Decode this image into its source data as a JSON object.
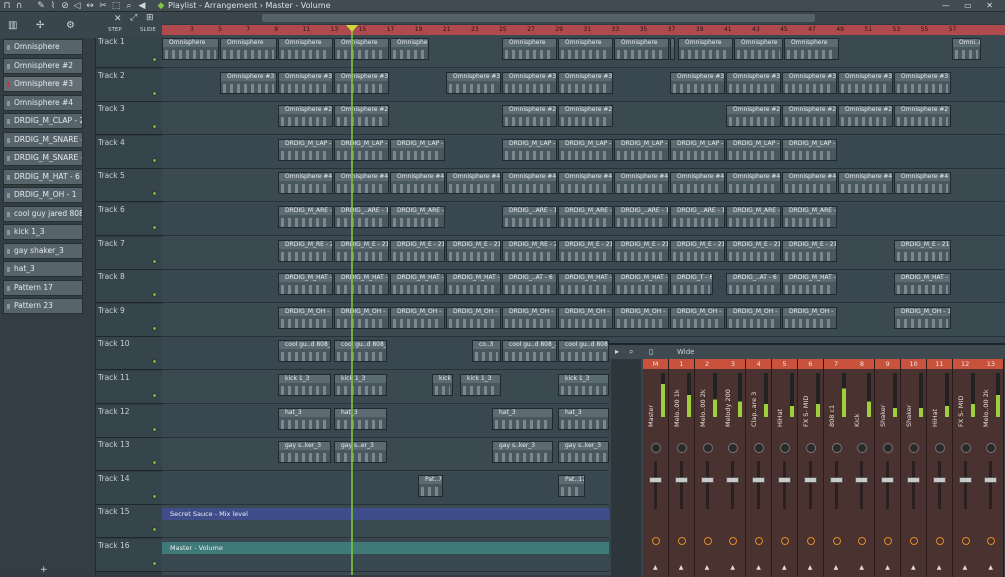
{
  "titlebar": {
    "title": "Playlist - Arrangement",
    "separator": "›",
    "target": "Master - Volume",
    "icons": [
      "magnet-icon",
      "draw-icon",
      "paint-icon",
      "delete-icon",
      "mute-icon",
      "slip-icon",
      "slice-icon",
      "select-icon",
      "zoom-icon",
      "playback-icon"
    ],
    "window_controls": "— ▭ ✕"
  },
  "playlist_tools": {
    "step_label": "STEP",
    "slide_label": "SLIDE"
  },
  "browser": {
    "channels": [
      {
        "label": "Omnisphere",
        "led": "gray"
      },
      {
        "label": "Omnisphere #2",
        "led": "gray"
      },
      {
        "label": "Omnisphere #3",
        "led": "red"
      },
      {
        "label": "Omnisphere #4",
        "led": "gray"
      },
      {
        "label": "DRDIG_M_CLAP - 2",
        "led": "gray"
      },
      {
        "label": "DRDIG_M_SNARE - 21",
        "led": "gray"
      },
      {
        "label": "DRDIG_M_SNARE - 1",
        "led": "gray"
      },
      {
        "label": "DRDIG_M_HAT - 6",
        "led": "gray"
      },
      {
        "label": "DRDIG_M_OH - 1",
        "led": "gray"
      },
      {
        "label": "cool guy jared 808_3",
        "led": "gray"
      },
      {
        "label": "kick 1_3",
        "led": "gray"
      },
      {
        "label": "gay shaker_3",
        "led": "gray"
      },
      {
        "label": "hat_3",
        "led": "gray"
      },
      {
        "label": "Pattern 17",
        "led": "gray"
      },
      {
        "label": "Pattern 23",
        "led": "gray"
      }
    ],
    "add_label": "+"
  },
  "ruler": {
    "bars": [
      "3",
      "5",
      "7",
      "9",
      "11",
      "13",
      "15",
      "17",
      "19",
      "21",
      "23",
      "25",
      "27",
      "29",
      "31",
      "33",
      "35",
      "37",
      "39",
      "41",
      "43",
      "45",
      "47",
      "49",
      "51",
      "53",
      "55",
      "57"
    ]
  },
  "tracks": [
    {
      "name": "Track 1",
      "clips": [
        {
          "start": 0,
          "end": 58,
          "label": "Omnisphere"
        },
        {
          "start": 58,
          "end": 116,
          "label": "Omnisphere"
        },
        {
          "start": 116,
          "end": 172,
          "label": "Omnisphere"
        },
        {
          "start": 172,
          "end": 228,
          "label": "Omnisphere"
        },
        {
          "start": 228,
          "end": 268,
          "label": "Omnisphere"
        },
        {
          "start": 340,
          "end": 396,
          "label": "Omnisphere"
        },
        {
          "start": 396,
          "end": 452,
          "label": "Omnisphere"
        },
        {
          "start": 452,
          "end": 508,
          "label": "Omnisphere"
        },
        {
          "start": 508,
          "end": 514,
          "label": "Omnisphere"
        },
        {
          "start": 516,
          "end": 572,
          "label": "Omnisphere"
        },
        {
          "start": 572,
          "end": 622,
          "label": "Omnisphere"
        },
        {
          "start": 622,
          "end": 678,
          "label": "Omnisphere"
        },
        {
          "start": 790,
          "end": 820,
          "label": "Omni..re"
        }
      ]
    },
    {
      "name": "Track 2",
      "clips": [
        {
          "start": 58,
          "end": 116,
          "label": "Omnisphere #3"
        },
        {
          "start": 116,
          "end": 172,
          "label": "Omnisphere #3"
        },
        {
          "start": 172,
          "end": 228,
          "label": "Omnisphere #3"
        },
        {
          "start": 284,
          "end": 340,
          "label": "Omnisphere #3"
        },
        {
          "start": 340,
          "end": 396,
          "label": "Omnisphere #3"
        },
        {
          "start": 396,
          "end": 452,
          "label": "Omnisphere #3"
        },
        {
          "start": 508,
          "end": 564,
          "label": "Omnisphere #3"
        },
        {
          "start": 564,
          "end": 620,
          "label": "Omnisphere #3"
        },
        {
          "start": 620,
          "end": 676,
          "label": "Omnisphere #3"
        },
        {
          "start": 676,
          "end": 732,
          "label": "Omnisphere #3"
        },
        {
          "start": 732,
          "end": 790,
          "label": "Omnisphere #3"
        }
      ]
    },
    {
      "name": "Track 3",
      "clips": [
        {
          "start": 116,
          "end": 172,
          "label": "Omnisphere #2"
        },
        {
          "start": 172,
          "end": 228,
          "label": "Omnisphere #2"
        },
        {
          "start": 340,
          "end": 396,
          "label": "Omnisphere #2"
        },
        {
          "start": 396,
          "end": 452,
          "label": "Omnisphere #2"
        },
        {
          "start": 564,
          "end": 620,
          "label": "Omnisphere #2"
        },
        {
          "start": 620,
          "end": 676,
          "label": "Omnisphere #2"
        },
        {
          "start": 676,
          "end": 732,
          "label": "Omnisphere #2"
        },
        {
          "start": 732,
          "end": 790,
          "label": "Omnisphere #2"
        }
      ]
    },
    {
      "name": "Track 4",
      "clips": [
        {
          "start": 116,
          "end": 172,
          "label": "DRDIG_M_LAP - 2"
        },
        {
          "start": 172,
          "end": 228,
          "label": "DRDIG_M_LAP - 2"
        },
        {
          "start": 228,
          "end": 284,
          "label": "DRDIG_M_LAP - 2"
        },
        {
          "start": 340,
          "end": 396,
          "label": "DRDIG_M_LAP - 2"
        },
        {
          "start": 396,
          "end": 452,
          "label": "DRDIG_M_LAP - 2"
        },
        {
          "start": 452,
          "end": 508,
          "label": "DRDIG_M_LAP - 2"
        },
        {
          "start": 508,
          "end": 564,
          "label": "DRDIG_M_LAP - 2"
        },
        {
          "start": 564,
          "end": 620,
          "label": "DRDIG_M_LAP - 2"
        },
        {
          "start": 620,
          "end": 676,
          "label": "DRDIG_M_LAP - 2"
        }
      ]
    },
    {
      "name": "Track 5",
      "clips": [
        {
          "start": 116,
          "end": 172,
          "label": "Omnisphere #4"
        },
        {
          "start": 172,
          "end": 228,
          "label": "Omnisphere #4"
        },
        {
          "start": 228,
          "end": 284,
          "label": "Omnisphere #4"
        },
        {
          "start": 284,
          "end": 340,
          "label": "Omnisphere #4"
        },
        {
          "start": 340,
          "end": 396,
          "label": "Omnisphere #4"
        },
        {
          "start": 396,
          "end": 452,
          "label": "Omnisphere #4"
        },
        {
          "start": 452,
          "end": 508,
          "label": "Omnisphere #4"
        },
        {
          "start": 508,
          "end": 564,
          "label": "Omnisphere #4"
        },
        {
          "start": 564,
          "end": 620,
          "label": "Omnisphere #4"
        },
        {
          "start": 620,
          "end": 676,
          "label": "Omnisphere #4"
        },
        {
          "start": 676,
          "end": 732,
          "label": "Omnisphere #4"
        },
        {
          "start": 732,
          "end": 790,
          "label": "Omnisphere #4"
        }
      ]
    },
    {
      "name": "Track 6",
      "clips": [
        {
          "start": 116,
          "end": 172,
          "label": "DRDIG_M_ARE - 1"
        },
        {
          "start": 172,
          "end": 228,
          "label": "DRDIG_..ARE - 1"
        },
        {
          "start": 228,
          "end": 284,
          "label": "DRDIG_M_ARE - 1"
        },
        {
          "start": 340,
          "end": 396,
          "label": "DRDIG_..ARE - 1"
        },
        {
          "start": 396,
          "end": 452,
          "label": "DRDIG_M_ARE - 1"
        },
        {
          "start": 452,
          "end": 508,
          "label": "DRDIG_..ARE - 1"
        },
        {
          "start": 508,
          "end": 564,
          "label": "DRDIG_..ARE - 1"
        },
        {
          "start": 564,
          "end": 620,
          "label": "DRDIG_M_ARE - 1"
        },
        {
          "start": 620,
          "end": 676,
          "label": "DRDIG_M_ARE - 1"
        }
      ]
    },
    {
      "name": "Track 7",
      "clips": [
        {
          "start": 116,
          "end": 172,
          "label": "DRDIG_M_RE - 21"
        },
        {
          "start": 172,
          "end": 228,
          "label": "DRDIG_M_E - 21"
        },
        {
          "start": 228,
          "end": 284,
          "label": "DRDIG_M_E - 21"
        },
        {
          "start": 284,
          "end": 340,
          "label": "DRDIG_M_E - 21"
        },
        {
          "start": 340,
          "end": 396,
          "label": "DRDIG_M_RE - 21"
        },
        {
          "start": 396,
          "end": 452,
          "label": "DRDIG_M_E - 21"
        },
        {
          "start": 452,
          "end": 508,
          "label": "DRDIG_M_E - 21"
        },
        {
          "start": 508,
          "end": 564,
          "label": "DRDIG_M_E - 21"
        },
        {
          "start": 564,
          "end": 620,
          "label": "DRDIG_M_E - 21"
        },
        {
          "start": 620,
          "end": 676,
          "label": "DRDIG_M_E - 21"
        },
        {
          "start": 732,
          "end": 790,
          "label": "DRDIG_M_E - 21"
        }
      ]
    },
    {
      "name": "Track 8",
      "clips": [
        {
          "start": 116,
          "end": 172,
          "label": "DRDIG_M_HAT - 6"
        },
        {
          "start": 172,
          "end": 228,
          "label": "DRDIG_M_HAT - 6"
        },
        {
          "start": 228,
          "end": 284,
          "label": "DRDIG_M_HAT - 6"
        },
        {
          "start": 284,
          "end": 340,
          "label": "DRDIG_M_HAT - 6"
        },
        {
          "start": 340,
          "end": 396,
          "label": "DRDIG_..AT - 6"
        },
        {
          "start": 396,
          "end": 452,
          "label": "DRDIG_M_HAT - 6"
        },
        {
          "start": 452,
          "end": 508,
          "label": "DRDIG_M_HAT - 6"
        },
        {
          "start": 508,
          "end": 552,
          "label": "DRDIG_T - 6"
        },
        {
          "start": 564,
          "end": 620,
          "label": "DRDIG_..AT - 6"
        },
        {
          "start": 620,
          "end": 676,
          "label": "DRDIG_M_HAT - 6"
        },
        {
          "start": 732,
          "end": 790,
          "label": "DRDIG_M_HAT - 6"
        }
      ]
    },
    {
      "name": "Track 9",
      "clips": [
        {
          "start": 116,
          "end": 172,
          "label": "DRDIG_M_OH - 1"
        },
        {
          "start": 172,
          "end": 228,
          "label": "DRDIG_M_OH - 1"
        },
        {
          "start": 228,
          "end": 284,
          "label": "DRDIG_M_OH - 1"
        },
        {
          "start": 284,
          "end": 340,
          "label": "DRDIG_M_OH - 1"
        },
        {
          "start": 340,
          "end": 396,
          "label": "DRDIG_M_OH - 1"
        },
        {
          "start": 396,
          "end": 452,
          "label": "DRDIG_M_OH - 1"
        },
        {
          "start": 452,
          "end": 508,
          "label": "DRDIG_M_OH - 1"
        },
        {
          "start": 508,
          "end": 564,
          "label": "DRDIG_M_OH - 1"
        },
        {
          "start": 564,
          "end": 620,
          "label": "DRDIG_M_OH - 1"
        },
        {
          "start": 620,
          "end": 676,
          "label": "DRDIG_M_OH - 1"
        },
        {
          "start": 732,
          "end": 790,
          "label": "DRDIG_M_OH - 1"
        }
      ]
    },
    {
      "name": "Track 10",
      "clips": [
        {
          "start": 116,
          "end": 170,
          "label": "cool gu..d 808_3"
        },
        {
          "start": 172,
          "end": 226,
          "label": "cool gu..d 808_3"
        },
        {
          "start": 310,
          "end": 340,
          "label": "co..3"
        },
        {
          "start": 340,
          "end": 396,
          "label": "cool gu..d 808_3"
        },
        {
          "start": 396,
          "end": 448,
          "label": "cool gu..d 808_3"
        }
      ]
    },
    {
      "name": "Track 11",
      "clips": [
        {
          "start": 116,
          "end": 170,
          "label": "kick 1_3"
        },
        {
          "start": 172,
          "end": 226,
          "label": "kick 1_3"
        },
        {
          "start": 270,
          "end": 292,
          "label": "kick 1_3"
        },
        {
          "start": 298,
          "end": 340,
          "label": "kick 1_3"
        },
        {
          "start": 396,
          "end": 448,
          "label": "kick 1_3"
        }
      ]
    },
    {
      "name": "Track 12",
      "clips": [
        {
          "start": 116,
          "end": 170,
          "label": "hat_3"
        },
        {
          "start": 172,
          "end": 226,
          "label": "hat_3"
        },
        {
          "start": 330,
          "end": 392,
          "label": "hat_3"
        },
        {
          "start": 396,
          "end": 448,
          "label": "hat_3"
        }
      ]
    },
    {
      "name": "Track 13",
      "clips": [
        {
          "start": 116,
          "end": 170,
          "label": "gay s..ker_3"
        },
        {
          "start": 172,
          "end": 226,
          "label": "gay s..er_3"
        },
        {
          "start": 330,
          "end": 392,
          "label": "gay s..ker_3"
        },
        {
          "start": 396,
          "end": 448,
          "label": "gay s..ker_3"
        }
      ]
    },
    {
      "name": "Track 14",
      "clips": [
        {
          "start": 256,
          "end": 282,
          "label": "Pat..7"
        },
        {
          "start": 396,
          "end": 424,
          "label": "Pat..17"
        }
      ]
    },
    {
      "name": "Track 15",
      "clips": []
    },
    {
      "name": "Track 16",
      "clips": []
    }
  ],
  "automation": [
    {
      "track": 14,
      "label": "Secret Sauce - Mix level",
      "color": "#3f4d8a"
    },
    {
      "track": 15,
      "label": "Master - Volume",
      "color": "#3f7a78"
    }
  ],
  "mixer": {
    "title": "Wide",
    "strips": [
      {
        "num": "M",
        "name": "Master",
        "meter": 0.75
      },
      {
        "num": "1",
        "name": "Melo..00 1k",
        "meter": 0.5
      },
      {
        "num": "2",
        "name": "Melo..00 2k",
        "meter": 0.4
      },
      {
        "num": "3",
        "name": "Melody 200",
        "meter": 0.35
      },
      {
        "num": "4",
        "name": "Clap..are 3",
        "meter": 0.3
      },
      {
        "num": "5",
        "name": "HiHat",
        "meter": 0.25
      },
      {
        "num": "6",
        "name": "FX S- MID",
        "meter": 0.3
      },
      {
        "num": "7",
        "name": "808 c1",
        "meter": 0.65
      },
      {
        "num": "8",
        "name": "Kick",
        "meter": 0.35
      },
      {
        "num": "9",
        "name": "Shaker",
        "meter": 0.2
      },
      {
        "num": "10",
        "name": "Shaker",
        "meter": 0.2
      },
      {
        "num": "11",
        "name": "HiHat",
        "meter": 0.25
      },
      {
        "num": "12",
        "name": "FX S- MID",
        "meter": 0.3
      },
      {
        "num": "13",
        "name": "Melo..00 2k",
        "meter": 0.5
      }
    ]
  }
}
